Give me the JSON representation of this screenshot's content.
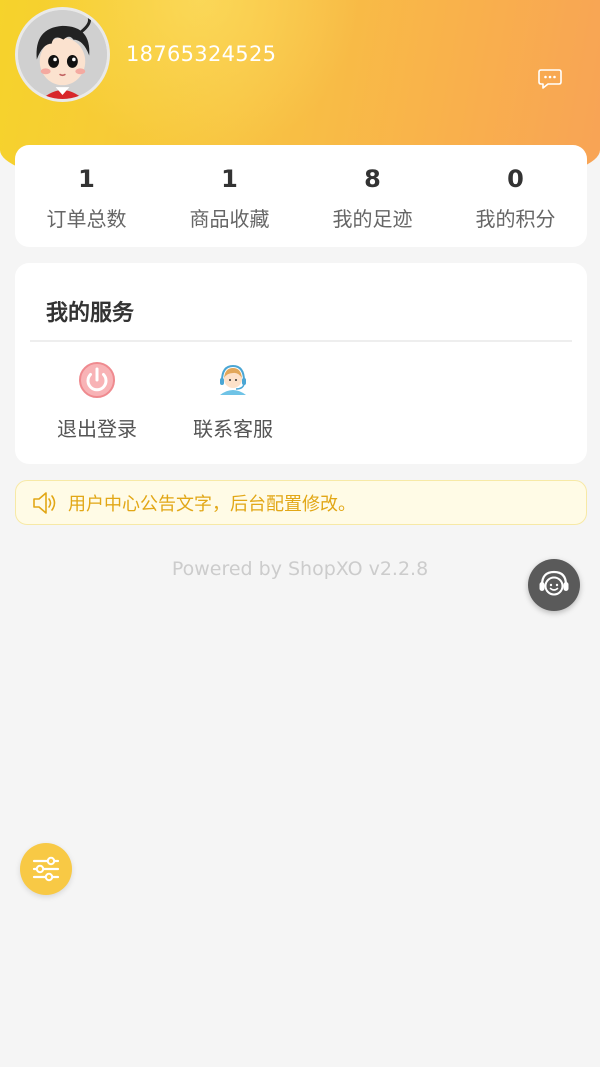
{
  "user": {
    "phone": "18765324525"
  },
  "stats": [
    {
      "value": "1",
      "label": "订单总数"
    },
    {
      "value": "1",
      "label": "商品收藏"
    },
    {
      "value": "8",
      "label": "我的足迹"
    },
    {
      "value": "0",
      "label": "我的积分"
    }
  ],
  "services": {
    "title": "我的服务",
    "items": [
      {
        "label": "退出登录",
        "icon": "power-icon"
      },
      {
        "label": "联系客服",
        "icon": "customer-service-icon"
      }
    ]
  },
  "notice": {
    "text": "用户中心公告文字，后台配置修改。",
    "icon": "speaker-icon"
  },
  "footer": {
    "powered": "Powered by ShopXO v2.2.8"
  },
  "colors": {
    "header_gradient_start": "#f6d32b",
    "header_gradient_end": "#f8a356",
    "notice_text": "#e2a716",
    "notice_bg": "#fffbe6",
    "menu_button": "#f8c945",
    "cs_button": "#5a5a5a"
  }
}
